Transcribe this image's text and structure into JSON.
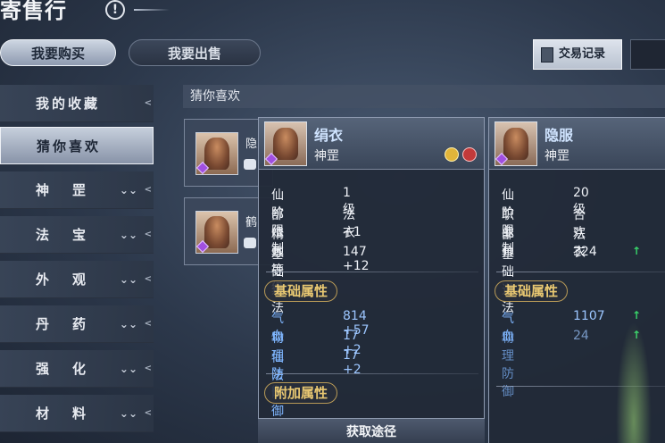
{
  "window": {
    "title": "寄售行",
    "help_glyph": "!"
  },
  "top_tabs": {
    "buy": "我要购买",
    "sell": "我要出售",
    "trade_record": "交易记录"
  },
  "sidebar": {
    "items": [
      {
        "label": "我的收藏",
        "has_arrow": false
      },
      {
        "label": "猜你喜欢",
        "has_arrow": false,
        "selected": true
      },
      {
        "label": "神罡",
        "has_arrow": true
      },
      {
        "label": "法宝",
        "has_arrow": true
      },
      {
        "label": "外观",
        "has_arrow": true
      },
      {
        "label": "丹药",
        "has_arrow": true
      },
      {
        "label": "强化",
        "has_arrow": true
      },
      {
        "label": "材料",
        "has_arrow": true
      }
    ],
    "arrow_glyph": "⌄⌄",
    "pointer_glyph": "<"
  },
  "main": {
    "header": "猜你喜欢",
    "cards": [
      {
        "name": "隐"
      },
      {
        "name": "鹤"
      }
    ]
  },
  "tooltip_left": {
    "name": "绢衣",
    "grade": "神罡",
    "rows": [
      {
        "key": "仙阶限制",
        "value": "1级"
      },
      {
        "key": "部位",
        "value": "法衣"
      },
      {
        "key": "精炼等级",
        "value": "+1"
      },
      {
        "key": "基础道法",
        "value": "147 +12"
      }
    ],
    "basic_section": "基础属性",
    "basic_rows": [
      {
        "key": "气血",
        "value": "814  +57"
      },
      {
        "key": "物理防御",
        "value": "17  +2"
      },
      {
        "key": "仙法防御",
        "value": "17  +2"
      }
    ],
    "extra_section": "附加属性",
    "acquire_button": "获取途径"
  },
  "tooltip_right": {
    "name": "隐服",
    "grade": "神罡",
    "rows": [
      {
        "key": "仙阶限制",
        "value": "20级"
      },
      {
        "key": "职业",
        "value": "合欢"
      },
      {
        "key": "部位",
        "value": "法衣"
      },
      {
        "key": "基础道法",
        "value": "324"
      }
    ],
    "basic_section": "基础属性",
    "basic_rows": [
      {
        "key": "气血",
        "value": "1107"
      },
      {
        "key": "物理防御",
        "value": "24"
      }
    ],
    "up_arrow": "↑"
  },
  "colors": {
    "accent_gold": "#e9c872",
    "stat_blue": "#7fb6ff",
    "increase_green": "#38d46a",
    "coin_gold": "#e2b53a",
    "coin_red": "#c23a3a"
  }
}
